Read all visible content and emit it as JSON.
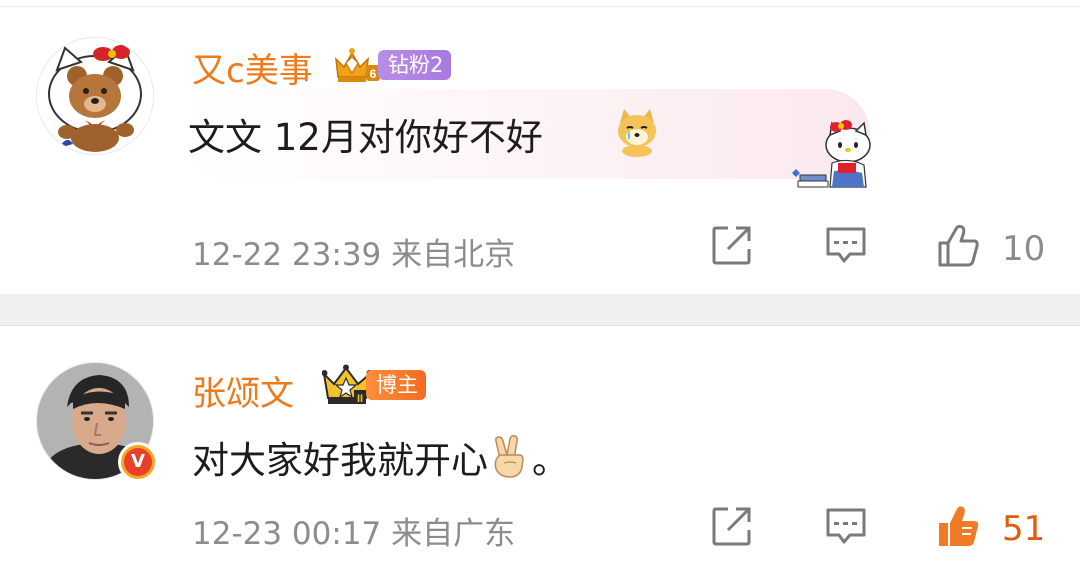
{
  "comments": [
    {
      "username": "又c美事",
      "badge_label": "钻粉2",
      "badge_icon": "diamond-fan-crown-icon",
      "text": "文文 12月对你好不好",
      "emoji": "crying-dog-emoji",
      "time": "12-22 23:39",
      "location": "来自北京",
      "like_count": "10",
      "liked": false,
      "avatar": "teddy-bear-hello-kitty-avatar",
      "decoration": "hello-kitty-bubble-decoration"
    },
    {
      "username": "张颂文",
      "badge_label": "博主",
      "badge_icon": "crown-level-icon",
      "text": "对大家好我就开心",
      "emoji": "victory-hand-emoji",
      "text_suffix": "。",
      "time": "12-23 00:17",
      "location": "来自广东",
      "like_count": "51",
      "liked": true,
      "avatar": "man-portrait-avatar",
      "verified": "V"
    }
  ],
  "colors": {
    "username": "#ee7a1b",
    "diamond_badge": "#a979e0",
    "blogger_badge": "#f36c21",
    "liked": "#e35b0d",
    "meta_text": "#8c8c8c",
    "divider": "#efefef"
  }
}
